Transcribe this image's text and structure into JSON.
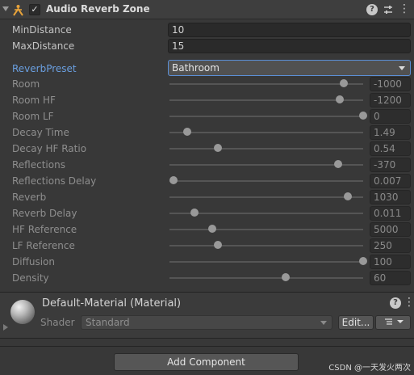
{
  "component": {
    "title": "Audio Reverb Zone",
    "enabled": true,
    "icon": "audio-reverb-zone-icon",
    "header_icons": [
      "help-icon",
      "presets-icon",
      "more-menu-icon"
    ]
  },
  "fields": {
    "min_distance": {
      "label": "MinDistance",
      "value": "10"
    },
    "max_distance": {
      "label": "MaxDistance",
      "value": "15"
    },
    "reverb_preset": {
      "label": "ReverbPreset",
      "value": "Bathroom"
    }
  },
  "sliders": [
    {
      "label": "Room",
      "value": "-1000",
      "fraction": 0.9
    },
    {
      "label": "Room HF",
      "value": "-1200",
      "fraction": 0.88
    },
    {
      "label": "Room LF",
      "value": "0",
      "fraction": 1.0
    },
    {
      "label": "Decay Time",
      "value": "1.49",
      "fraction": 0.09
    },
    {
      "label": "Decay HF Ratio",
      "value": "0.54",
      "fraction": 0.25
    },
    {
      "label": "Reflections",
      "value": "-370",
      "fraction": 0.87
    },
    {
      "label": "Reflections Delay",
      "value": "0.007",
      "fraction": 0.02
    },
    {
      "label": "Reverb",
      "value": "1030",
      "fraction": 0.92
    },
    {
      "label": "Reverb Delay",
      "value": "0.011",
      "fraction": 0.13
    },
    {
      "label": "HF Reference",
      "value": "5000",
      "fraction": 0.22
    },
    {
      "label": "LF Reference",
      "value": "250",
      "fraction": 0.25
    },
    {
      "label": "Diffusion",
      "value": "100",
      "fraction": 1.0
    },
    {
      "label": "Density",
      "value": "60",
      "fraction": 0.6
    }
  ],
  "material": {
    "title": "Default-Material (Material)",
    "shader_label": "Shader",
    "shader_value": "Standard",
    "edit_label": "Edit...",
    "list_icon": "list-icon",
    "header_icons": [
      "help-icon",
      "more-menu-icon"
    ]
  },
  "add_component": {
    "label": "Add Component"
  },
  "watermark": "CSDN @一天发火两次",
  "colors": {
    "accent": "#5b8fd6",
    "label_blue": "#6a9fe0",
    "background": "#383838"
  }
}
